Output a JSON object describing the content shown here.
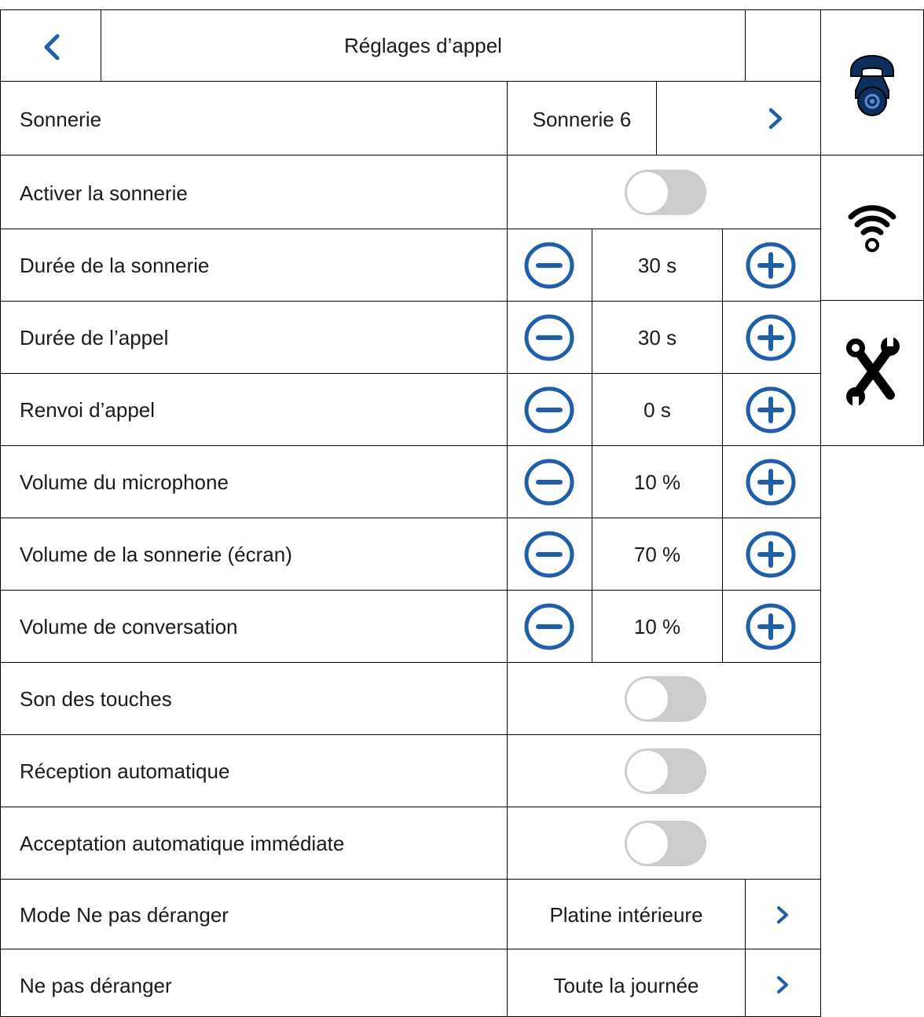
{
  "header": {
    "title": "Réglages d’appel",
    "back_icon": "chevron-left-icon"
  },
  "sidebar": {
    "items": [
      {
        "icon": "phone-settings-icon"
      },
      {
        "icon": "wifi-icon"
      },
      {
        "icon": "tools-icon"
      }
    ]
  },
  "rows": {
    "ringtone": {
      "label": "Sonnerie",
      "value": "Sonnerie 6"
    },
    "enable_ringtone": {
      "label": "Activer la sonnerie",
      "on": false
    },
    "ring_duration": {
      "label": "Durée de la sonnerie",
      "value": "30 s"
    },
    "call_duration": {
      "label": "Durée de l’appel",
      "value": "30 s"
    },
    "call_forward": {
      "label": "Renvoi d’appel",
      "value": "0 s"
    },
    "mic_volume": {
      "label": "Volume du microphone",
      "value": "10 %"
    },
    "ring_volume": {
      "label": "Volume de la sonnerie (écran)",
      "value": "70 %"
    },
    "talk_volume": {
      "label": "Volume de conversation",
      "value": "10 %"
    },
    "key_sound": {
      "label": "Son des touches",
      "on": false
    },
    "auto_reception": {
      "label": "Réception automatique",
      "on": false
    },
    "auto_accept": {
      "label": "Acceptation automatique immédiate",
      "on": false
    },
    "dnd_mode": {
      "label": "Mode Ne pas déranger",
      "value": "Platine intérieure"
    },
    "dnd": {
      "label": "Ne pas déranger",
      "value": "Toute la journée"
    }
  },
  "colors": {
    "accent": "#1f5fa8",
    "toggle_off": "#cccccc",
    "border": "#000000"
  }
}
